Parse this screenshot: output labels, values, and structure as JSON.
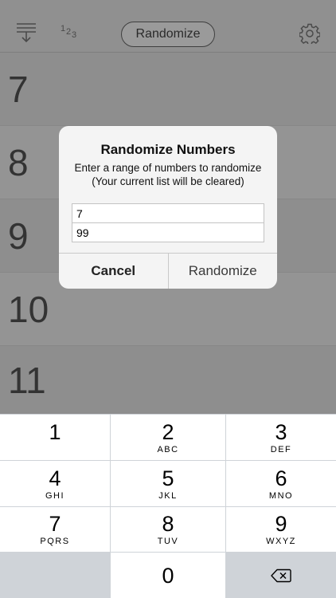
{
  "toolbar": {
    "sort_icon": "sort-down-icon",
    "number_icon": {
      "d1": "1",
      "d2": "2",
      "d3": "3"
    },
    "randomize_label": "Randomize",
    "settings_icon": "gear-icon"
  },
  "list": {
    "rows": [
      "7",
      "8",
      "9",
      "10",
      "11"
    ]
  },
  "alert": {
    "title": "Randomize Numbers",
    "message_line1": "Enter a range of numbers to randomize",
    "message_line2": "(Your current list will be cleared)",
    "field_min": "7",
    "field_max": "99",
    "cancel_label": "Cancel",
    "confirm_label": "Randomize"
  },
  "keypad": {
    "keys": [
      {
        "digit": "1",
        "letters": ""
      },
      {
        "digit": "2",
        "letters": "ABC"
      },
      {
        "digit": "3",
        "letters": "DEF"
      },
      {
        "digit": "4",
        "letters": "GHI"
      },
      {
        "digit": "5",
        "letters": "JKL"
      },
      {
        "digit": "6",
        "letters": "MNO"
      },
      {
        "digit": "7",
        "letters": "PQRS"
      },
      {
        "digit": "8",
        "letters": "TUV"
      },
      {
        "digit": "9",
        "letters": "WXYZ"
      },
      {
        "digit": "0",
        "letters": ""
      }
    ],
    "delete_icon": "backspace-icon"
  }
}
